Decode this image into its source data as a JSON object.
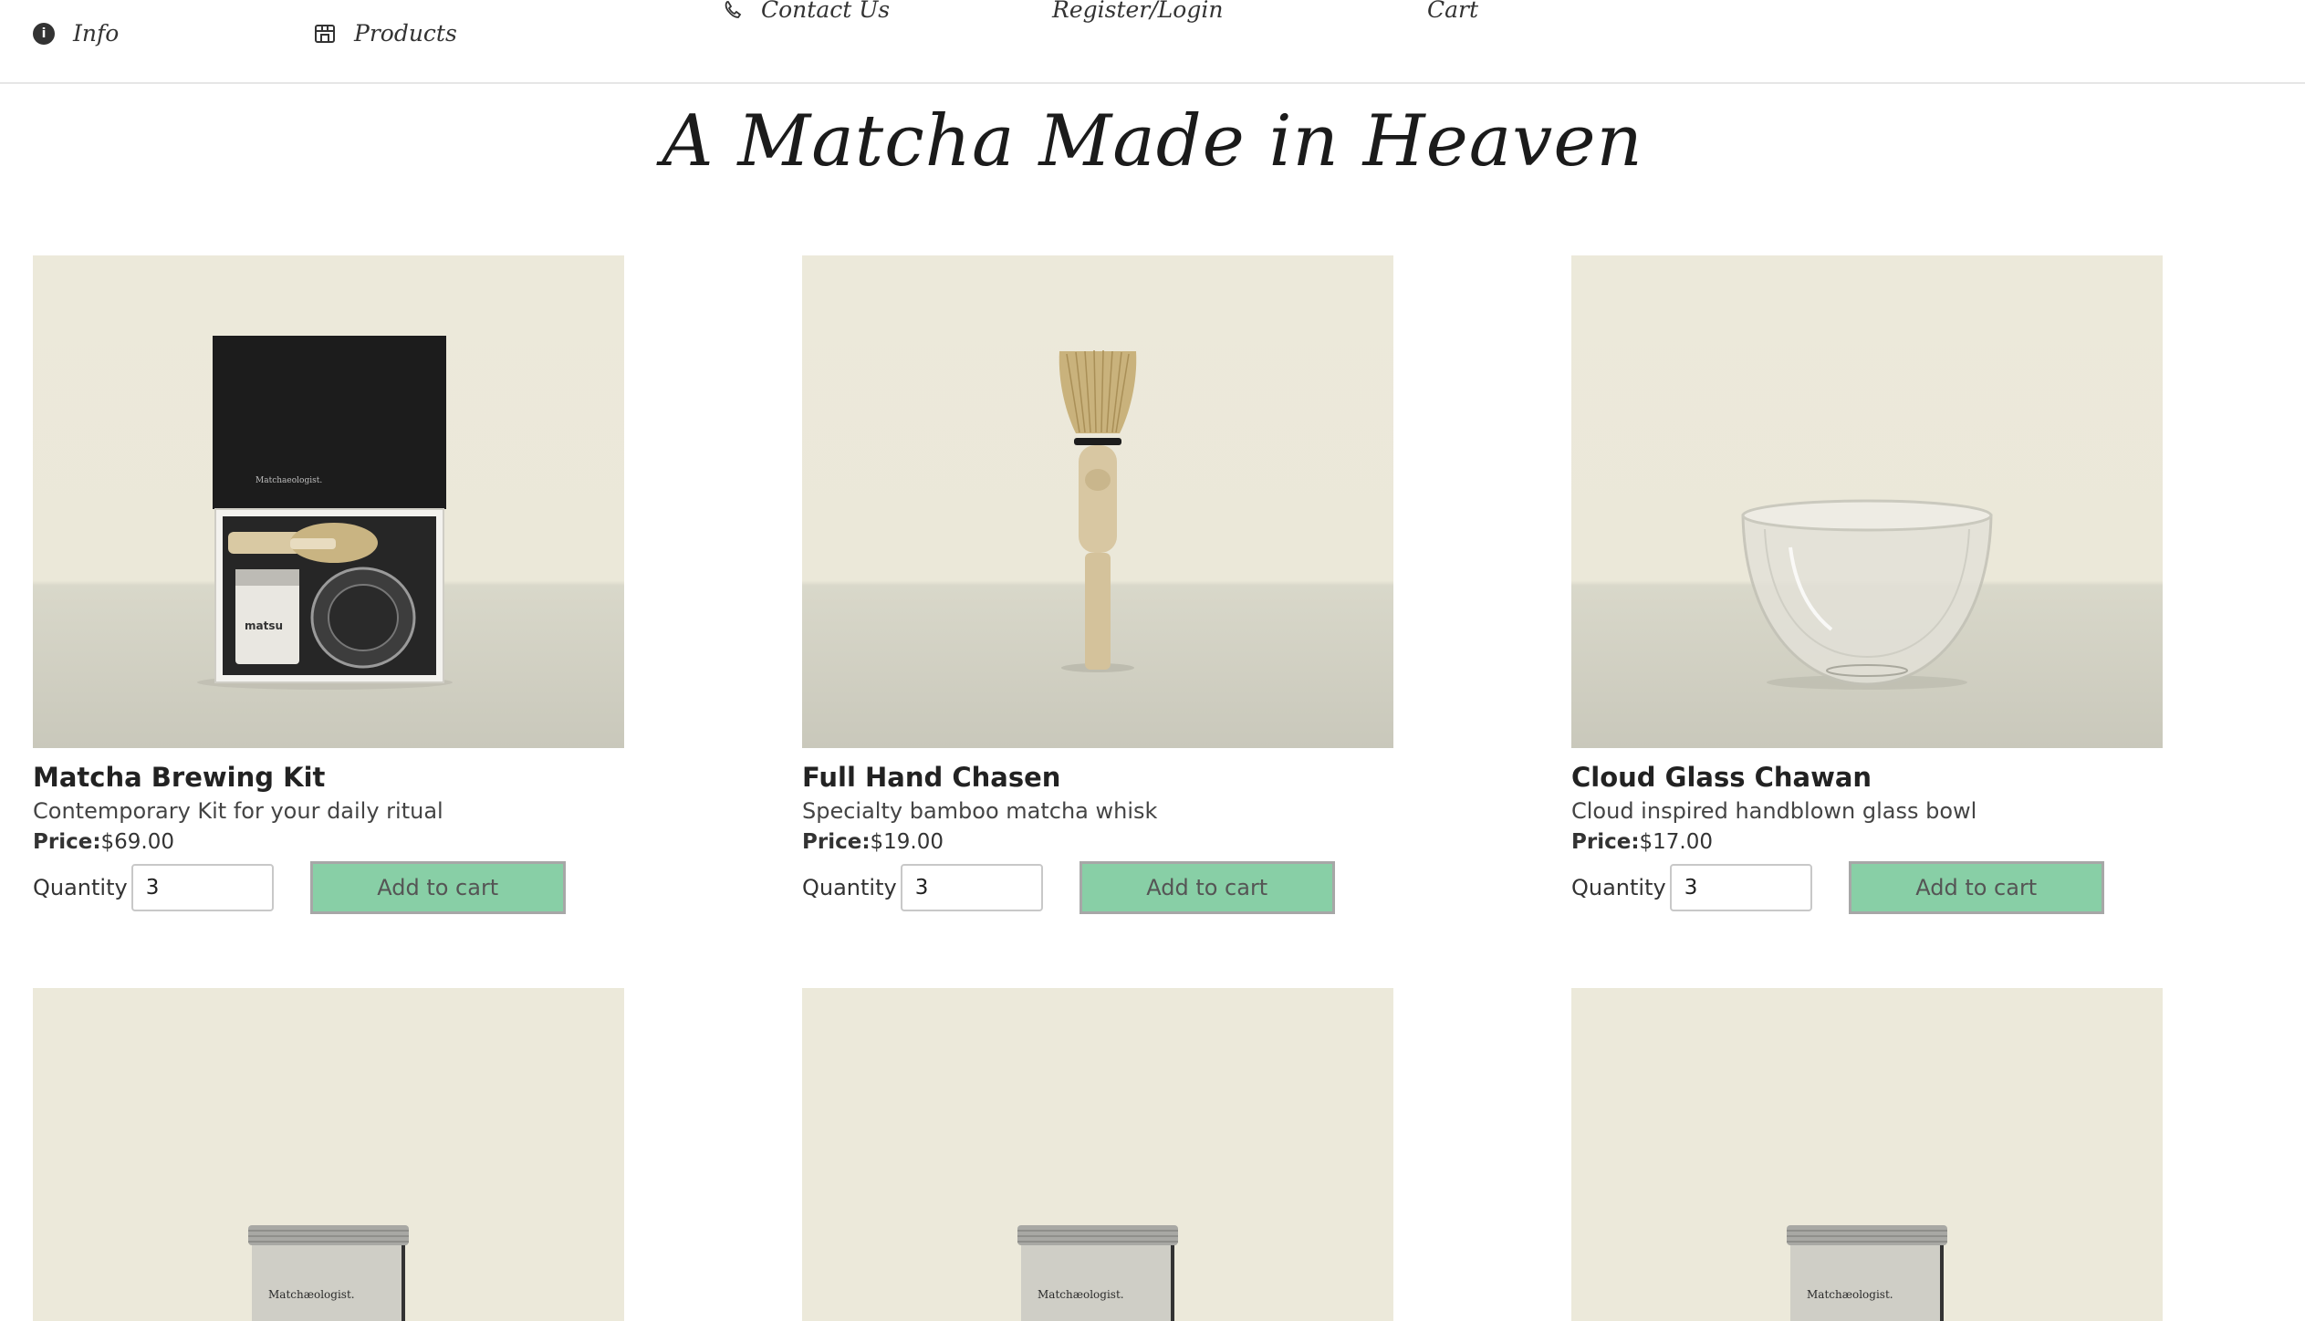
{
  "nav": {
    "info": "Info",
    "products": "Products",
    "contact": "Contact Us",
    "register": "Register/Login",
    "cart": "Cart"
  },
  "page_title": "A Matcha Made in Heaven",
  "product_labels": {
    "price": "Price:",
    "quantity": "Quantity",
    "add_to_cart": "Add to cart"
  },
  "products": [
    {
      "name": "Matcha Brewing Kit",
      "description": "Contemporary Kit for your daily ritual",
      "price": "$69.00",
      "quantity": "3",
      "image_icon": "brewing-kit-image",
      "image_text": "Matchaeologist.",
      "tin_text": "matsu"
    },
    {
      "name": "Full Hand Chasen",
      "description": "Specialty bamboo matcha whisk",
      "price": "$19.00",
      "quantity": "3",
      "image_icon": "bamboo-whisk-image"
    },
    {
      "name": "Cloud Glass Chawan",
      "description": "Cloud inspired handblown glass bowl",
      "price": "$17.00",
      "quantity": "3",
      "image_icon": "glass-bowl-image"
    }
  ],
  "row2_products": [
    {
      "image_icon": "matcha-tin-image",
      "tin_label": "Matchæologist."
    },
    {
      "image_icon": "matcha-tin-image",
      "tin_label": "Matchæologist."
    },
    {
      "image_icon": "matcha-tin-image",
      "tin_label": "Matchæologist."
    }
  ],
  "colors": {
    "button_green": "#88cfa6",
    "image_background": "#ece9da",
    "text_dark": "#222222"
  }
}
